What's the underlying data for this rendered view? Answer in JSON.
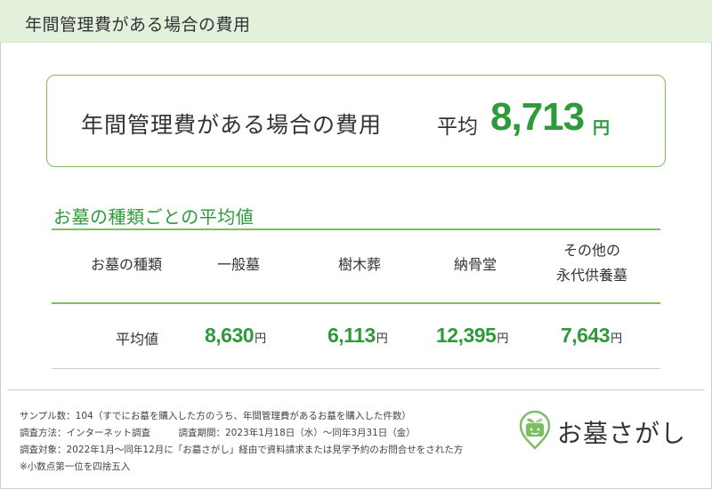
{
  "header": {
    "title": "年間管理費がある場合の費用"
  },
  "summary": {
    "label": "年間管理費がある場合の費用",
    "avg_label": "平均",
    "value": "8,713",
    "unit": "円"
  },
  "section": {
    "title": "お墓の種類ごとの平均値"
  },
  "table": {
    "header_label": "お墓の種類",
    "columns": [
      "一般墓",
      "樹木葬",
      "納骨堂",
      "その他の",
      "永代供養墓"
    ],
    "row_label": "平均値",
    "values": [
      "8,630",
      "6,113",
      "12,395",
      "7,643"
    ],
    "unit": "円"
  },
  "notes": [
    "サンプル数：104（すでにお墓を購入した方のうち、年間管理費があるお墓を購入した件数）",
    "調査方法：インターネット調査　　　調査期間：2023年1月18日（水）〜同年3月31日（金）",
    "調査対象：2022年1月〜同年12月に「お墓さがし」経由で資料請求または見学予約のお問合せをされた方",
    "※小数点第一位を四捨五入"
  ],
  "logo": {
    "text": "お墓さがし",
    "icon": "leaf-home-icon"
  },
  "colors": {
    "accent": "#2e9a3c",
    "border": "#7cbf63",
    "header_bg": "#e3f0dc"
  }
}
